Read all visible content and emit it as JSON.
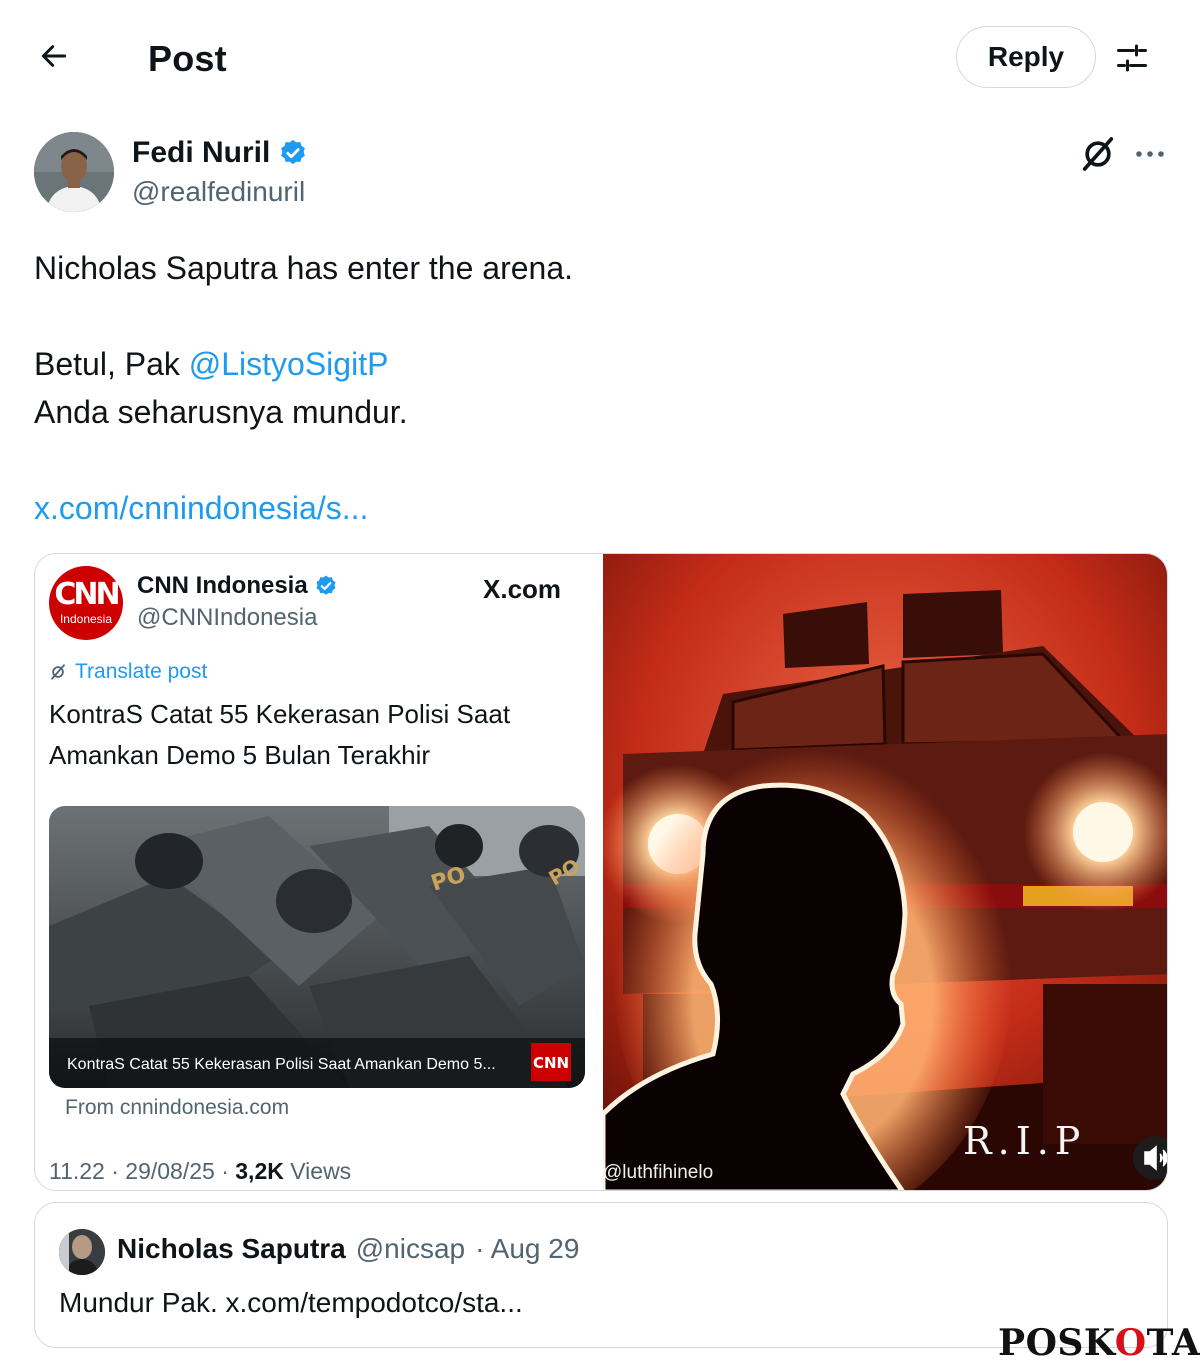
{
  "header": {
    "title": "Post",
    "reply_label": "Reply"
  },
  "author": {
    "name": "Fedi Nuril",
    "handle": "@realfedinuril",
    "verified": true
  },
  "post": {
    "line1": "Nicholas Saputra has enter the arena.",
    "line2_prefix": "Betul, Pak ",
    "mention": "@ListyoSigitP",
    "line3": "Anda seharusnya mundur.",
    "link": "x.com/cnnindonesia/s..."
  },
  "embedded_card": {
    "source_name": "CNN Indonesia",
    "source_handle": "@CNNIndonesia",
    "source_logo_text": "CNN",
    "source_logo_subtext": "Indonesia",
    "site_label": "X.com",
    "translate_label": "Translate post",
    "headline": "KontraS Catat 55 Kekerasan Polisi Saat Amankan Demo 5 Bulan Terakhir",
    "image_caption": "KontraS Catat 55 Kekerasan Polisi Saat Amankan Demo 5...",
    "from_label": "From cnnindonesia.com",
    "time": "11.22 · 29/08/25 · ",
    "views_count": "3,2K",
    "views_label": " Views",
    "illustration_credit": "@luthfihinelo",
    "illustration_text": "R.I.P"
  },
  "quoted_post": {
    "name": "Nicholas Saputra",
    "handle": "@nicsap",
    "date": "· Aug 29",
    "text": "Mundur Pak. x.com/tempodotco/sta..."
  },
  "watermark": {
    "part1": "POSK",
    "part2": "O",
    "part3": "TA"
  },
  "colors": {
    "link": "#1d9bf0",
    "verified": "#1d9bf0",
    "muted": "#536471",
    "border": "#cfd9de",
    "cnn_red": "#cc0000"
  },
  "icons": [
    "back-arrow-icon",
    "filter-icon",
    "verified-badge-icon",
    "grok-icon",
    "more-icon",
    "translate-icon",
    "volume-icon"
  ]
}
